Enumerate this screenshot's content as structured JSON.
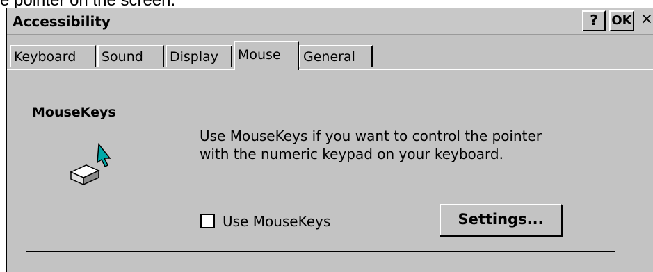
{
  "caption_fragment": "e pointer on the screen.",
  "window": {
    "title": "Accessibility",
    "help_label": "?",
    "ok_label": "OK",
    "close_label": "×"
  },
  "tabs": [
    {
      "label": "Keyboard",
      "active": false
    },
    {
      "label": "Sound",
      "active": false
    },
    {
      "label": "Display",
      "active": false
    },
    {
      "label": "Mouse",
      "active": true
    },
    {
      "label": "General",
      "active": false
    }
  ],
  "mousekeys": {
    "group_label": "MouseKeys",
    "description_line1": "Use MouseKeys if you want to control the pointer",
    "description_line2": "with the numeric keypad on your keyboard.",
    "checkbox_label": "Use MouseKeys",
    "checkbox_checked": false,
    "settings_label": "Settings...",
    "icon": "mousekeys-icon"
  },
  "colors": {
    "dialog_bg": "#c3c3c3",
    "arrow_fill": "#00a9a9"
  }
}
